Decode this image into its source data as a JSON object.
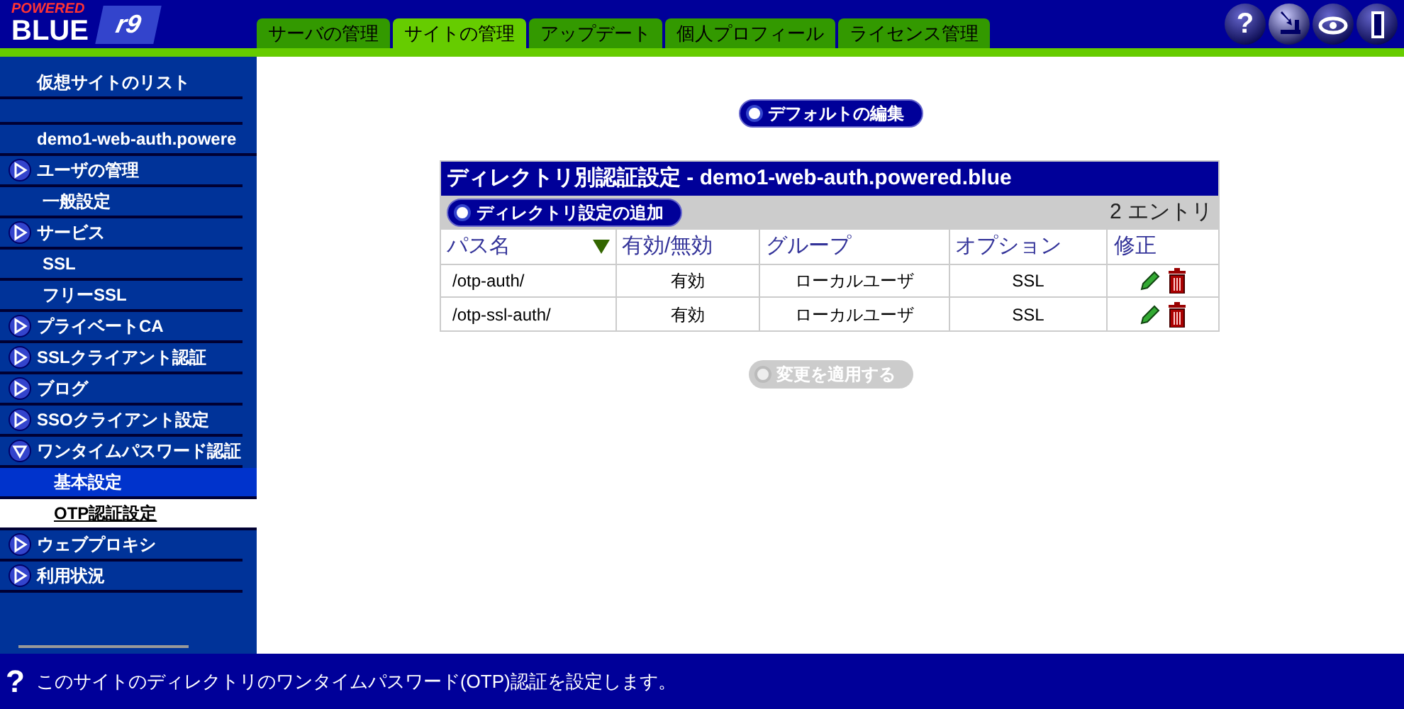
{
  "logo": {
    "top": "POWERED",
    "main": "BLUE",
    "version": "r9"
  },
  "tabs": [
    {
      "label": "サーバの管理",
      "selected": false
    },
    {
      "label": "サイトの管理",
      "selected": true
    },
    {
      "label": "アップデート",
      "selected": false
    },
    {
      "label": "個人プロフィール",
      "selected": false
    },
    {
      "label": "ライセンス管理",
      "selected": false
    }
  ],
  "toolbar": [
    {
      "kind": "help",
      "label": "?"
    },
    {
      "kind": "update"
    },
    {
      "kind": "view"
    },
    {
      "kind": "logout"
    }
  ],
  "sidebar": {
    "title": "仮想サイトのリスト",
    "site": "demo1-web-auth.powere",
    "items": [
      {
        "label": "ユーザの管理",
        "kind": "section",
        "expanded": false
      },
      {
        "label": "一般設定",
        "kind": "link"
      },
      {
        "label": "サービス",
        "kind": "section",
        "expanded": false
      },
      {
        "label": "SSL",
        "kind": "link"
      },
      {
        "label": "フリーSSL",
        "kind": "link"
      },
      {
        "label": "プライベートCA",
        "kind": "section",
        "expanded": false
      },
      {
        "label": "SSLクライアント認証",
        "kind": "section",
        "expanded": false
      },
      {
        "label": "ブログ",
        "kind": "section",
        "expanded": false
      },
      {
        "label": "SSOクライアント設定",
        "kind": "section",
        "expanded": false
      },
      {
        "label": "ワンタイムパスワード認証",
        "kind": "section",
        "expanded": true,
        "children": [
          {
            "label": "基本設定",
            "selected": false,
            "highlighted": true
          },
          {
            "label": "OTP認証設定",
            "selected": true
          }
        ]
      },
      {
        "label": "ウェブプロキシ",
        "kind": "section",
        "expanded": false
      },
      {
        "label": "利用状況",
        "kind": "section",
        "expanded": false
      }
    ]
  },
  "edit_defaults_button": "デフォルトの編集",
  "table": {
    "title": "ディレクトリ別認証設定 - demo1-web-auth.powered.blue",
    "add_button": "ディレクトリ設定の追加",
    "count": "2 エントリ",
    "columns": [
      {
        "label": "パス名",
        "sorted": true
      },
      {
        "label": "有効/無効",
        "sorted": false
      },
      {
        "label": "グループ",
        "sorted": false
      },
      {
        "label": "オプション",
        "sorted": false
      },
      {
        "label": "修正",
        "sorted": false
      }
    ],
    "rows": [
      [
        "/otp-auth/",
        "有効",
        "ローカルユーザ",
        "SSL"
      ],
      [
        "/otp-ssl-auth/",
        "有効",
        "ローカルユーザ",
        "SSL"
      ]
    ]
  },
  "apply_button": {
    "label": "変更を適用する",
    "disabled": true
  },
  "status_bar": {
    "icon": "?",
    "text": "このサイトのディレクトリのワンタイムパスワード(OTP)認証を設定します。"
  }
}
